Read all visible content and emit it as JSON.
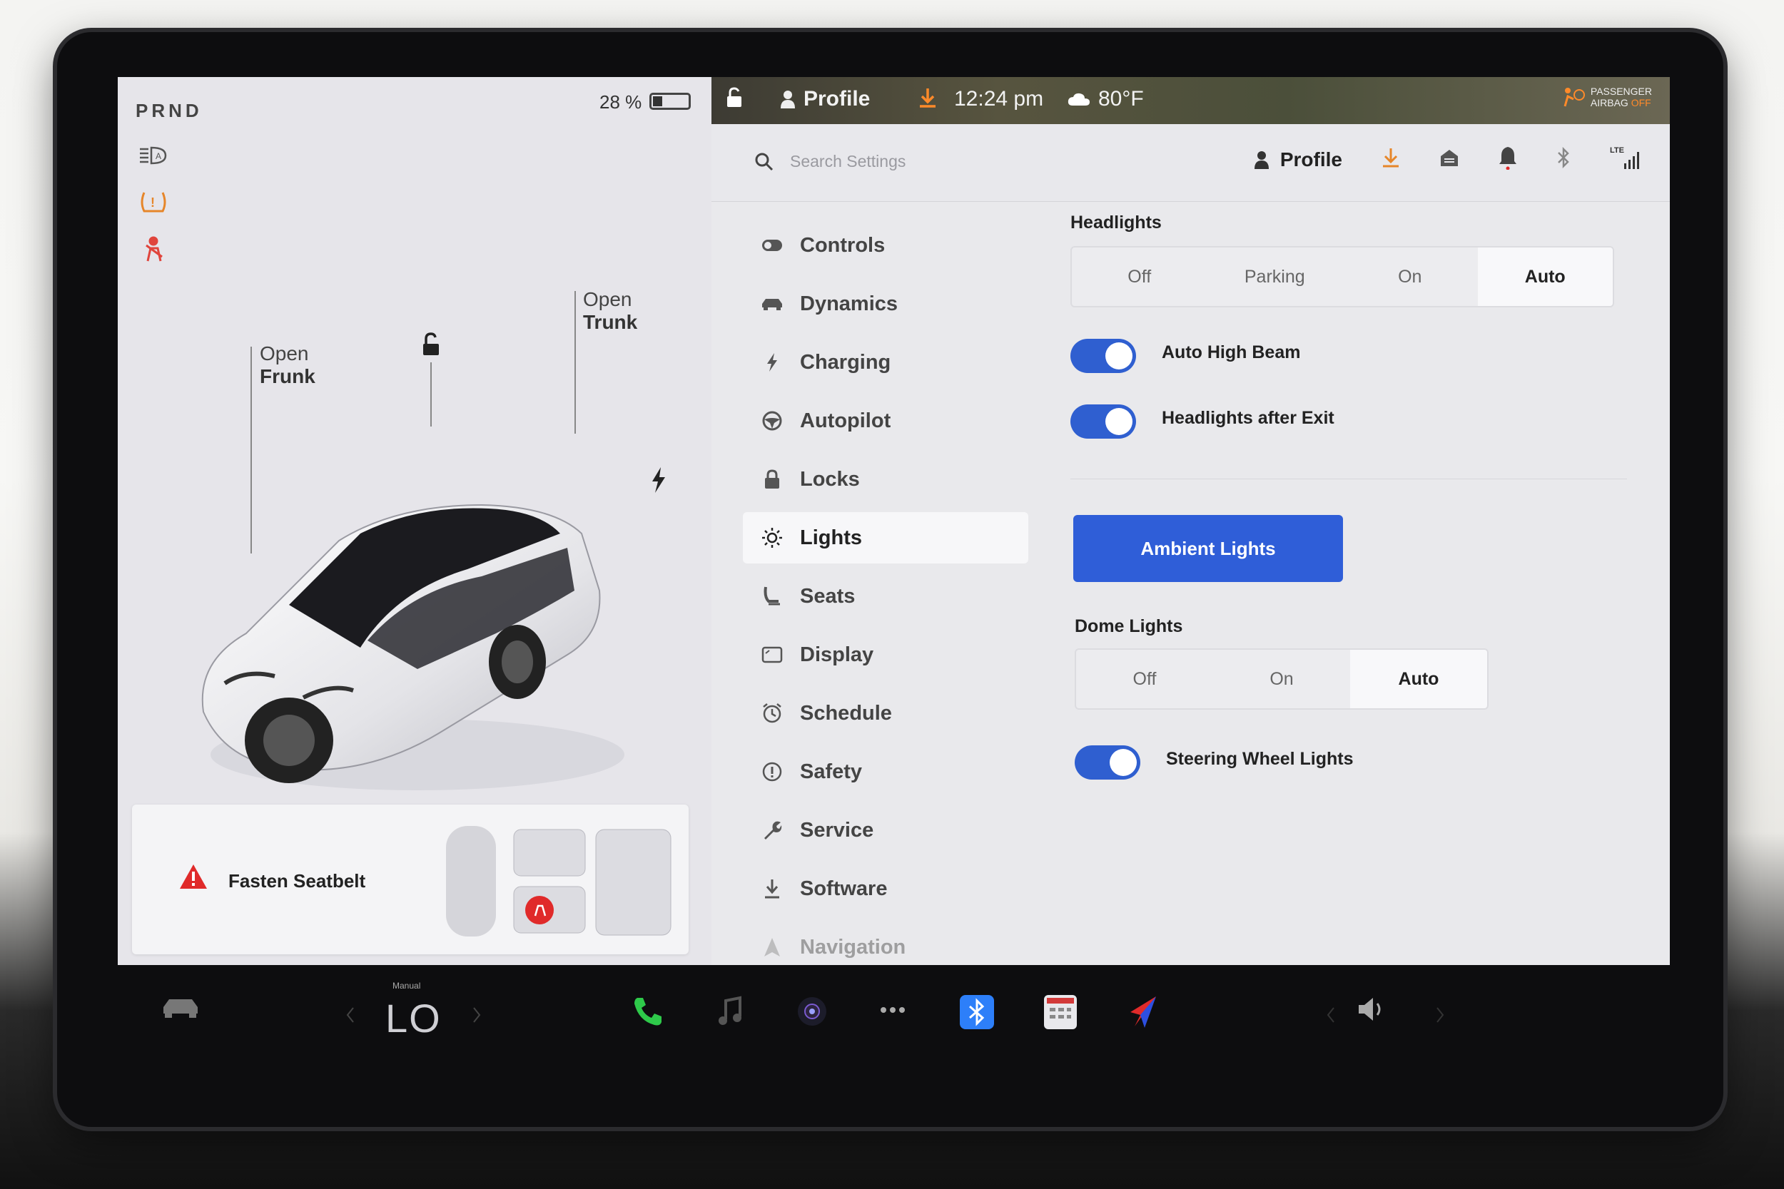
{
  "left_panel": {
    "gear": "PRND",
    "battery_percent": "28 %",
    "battery_level": 0.28,
    "callouts": {
      "frunk_line1": "Open",
      "frunk_line2": "Frunk",
      "trunk_line1": "Open",
      "trunk_line2": "Trunk"
    },
    "alert": {
      "text": "Fasten Seatbelt"
    },
    "status_icons": [
      "auto-headlight-icon",
      "tire-pressure-warning-icon",
      "seatbelt-warning-icon"
    ]
  },
  "topbar": {
    "profile": "Profile",
    "time": "12:24 pm",
    "temperature": "80°F",
    "airbag_line1": "PASSENGER",
    "airbag_line2": "AIRBAG",
    "airbag_state": "OFF"
  },
  "header": {
    "search_placeholder": "Search Settings",
    "profile": "Profile",
    "lte": "LTE"
  },
  "menu": {
    "items": [
      {
        "label": "Controls",
        "icon": "toggle-icon"
      },
      {
        "label": "Dynamics",
        "icon": "car-icon"
      },
      {
        "label": "Charging",
        "icon": "bolt-icon"
      },
      {
        "label": "Autopilot",
        "icon": "steering-wheel-icon"
      },
      {
        "label": "Locks",
        "icon": "lock-icon"
      },
      {
        "label": "Lights",
        "icon": "sun-icon"
      },
      {
        "label": "Seats",
        "icon": "seat-icon"
      },
      {
        "label": "Display",
        "icon": "display-icon"
      },
      {
        "label": "Schedule",
        "icon": "clock-icon"
      },
      {
        "label": "Safety",
        "icon": "alert-circle-icon"
      },
      {
        "label": "Service",
        "icon": "wrench-icon"
      },
      {
        "label": "Software",
        "icon": "download-icon"
      },
      {
        "label": "Navigation",
        "icon": "navigation-icon"
      }
    ],
    "active": "Lights"
  },
  "content": {
    "headlights": {
      "title": "Headlights",
      "options": [
        "Off",
        "Parking",
        "On",
        "Auto"
      ],
      "selected": "Auto"
    },
    "auto_high_beam": {
      "label": "Auto High Beam",
      "on": true
    },
    "headlights_after_exit": {
      "label": "Headlights after Exit",
      "on": true
    },
    "ambient_button": "Ambient Lights",
    "dome_lights": {
      "title": "Dome Lights",
      "options": [
        "Off",
        "On",
        "Auto"
      ],
      "selected": "Auto"
    },
    "steering_wheel_lights": {
      "label": "Steering Wheel Lights",
      "on": true
    }
  },
  "dock": {
    "temp_mode": "Manual",
    "temp_value": "LO",
    "colors": {
      "phone": "#2ec94a",
      "bluetooth": "#2d7ff9",
      "accent": "#2f5ed8"
    }
  }
}
